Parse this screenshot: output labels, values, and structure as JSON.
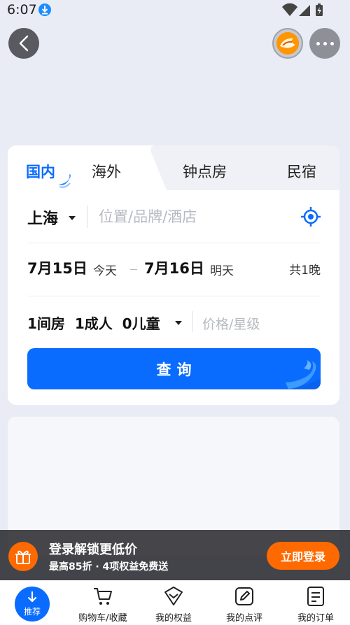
{
  "status_bar": {
    "time": "6:07"
  },
  "tabs": [
    {
      "label": "国内",
      "active": true
    },
    {
      "label": "海外",
      "active": false
    },
    {
      "label": "钟点房",
      "active": false
    },
    {
      "label": "民宿",
      "active": false
    }
  ],
  "search": {
    "city": "上海",
    "placeholder": "位置/品牌/酒店",
    "checkin_date": "7月15日",
    "checkin_day": "今天",
    "checkout_date": "7月16日",
    "checkout_day": "明天",
    "nights": "共1晚",
    "guests": "1间房  1成人  0儿童",
    "price_filter": "价格/星级",
    "query_label": "查询"
  },
  "banner": {
    "title": "登录解锁更低价",
    "subtitle": "最高85折 · 4项权益免费送",
    "login_label": "立即登录"
  },
  "bottom_nav": {
    "recommend": "推荐",
    "items": [
      {
        "label": "购物车/收藏"
      },
      {
        "label": "我的权益"
      },
      {
        "label": "我的点评"
      },
      {
        "label": "我的订单"
      }
    ]
  },
  "colors": {
    "accent": "#0a6cff",
    "orange": "#ff6a00"
  }
}
